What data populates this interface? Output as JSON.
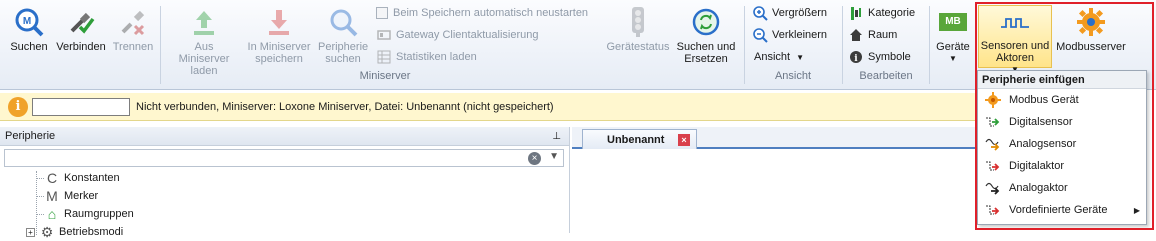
{
  "ribbon": {
    "buttons": {
      "search": "Suchen",
      "connect": "Verbinden",
      "disconnect": "Trennen",
      "load_from_ms": "Aus Miniserver laden",
      "save_to_ms": "In Miniserver speichern",
      "periphery_search": "Peripherie suchen",
      "device_status": "Gerätestatus",
      "search_replace": "Suchen und Ersetzen",
      "devices": "Geräte",
      "sensors_actors": "Sensoren und Aktoren",
      "modbus_server": "Modbusserver"
    },
    "options": {
      "auto_restart": "Beim Speichern automatisch neustarten",
      "gateway_update": "Gateway Clientaktualisierung",
      "load_stats": "Statistiken laden"
    },
    "view": {
      "zoom_in": "Vergrößern",
      "zoom_out": "Verkleinern",
      "view_menu": "Ansicht"
    },
    "edit": {
      "category": "Kategorie",
      "room": "Raum",
      "symbols": "Symbole"
    },
    "mb_badge": "MB",
    "groups": {
      "miniserver": "Miniserver",
      "view": "Ansicht",
      "edit": "Bearbeiten"
    }
  },
  "infobar": {
    "message": "Nicht verbunden, Miniserver: Loxone Miniserver, Datei: Unbenannt (nicht gespeichert)",
    "input_value": ""
  },
  "periphery": {
    "title": "Peripherie",
    "pin_glyph": "⊥",
    "search_value": "",
    "tree": [
      {
        "icon_glyph": "C",
        "label": "Konstanten"
      },
      {
        "icon_glyph": "M",
        "label": "Merker"
      },
      {
        "icon_glyph": "⌂",
        "label": "Raumgruppen"
      },
      {
        "icon_glyph": "⚙",
        "label": "Betriebsmodi"
      }
    ]
  },
  "document": {
    "tab_label": "Unbenannt",
    "close_glyph": "×"
  },
  "dropdown": {
    "header": "Peripherie einfügen",
    "items": [
      {
        "label": "Modbus Gerät",
        "icon": "modbus-gear-icon"
      },
      {
        "label": "Digitalsensor",
        "icon": "digital-sensor-icon"
      },
      {
        "label": "Analogsensor",
        "icon": "analog-sensor-icon"
      },
      {
        "label": "Digitalaktor",
        "icon": "digital-actor-icon"
      },
      {
        "label": "Analogaktor",
        "icon": "analog-actor-icon"
      },
      {
        "label": "Vordefinierte Geräte",
        "icon": "predefined-devices-icon",
        "has_submenu": true
      }
    ]
  },
  "colors": {
    "highlight_border": "#e0202a",
    "accent_blue": "#2a6fc9",
    "info_orange": "#f0a22a",
    "modbus_orange": "#f39a1e"
  }
}
